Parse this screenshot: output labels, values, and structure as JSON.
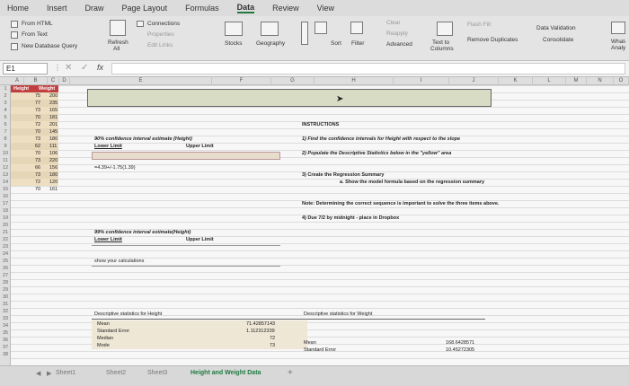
{
  "ribbon_tabs": [
    "Home",
    "Insert",
    "Draw",
    "Page Layout",
    "Formulas",
    "Data",
    "Review",
    "View"
  ],
  "active_tab": "Data",
  "ribbon": {
    "from_html": "From HTML",
    "from_text": "From Text",
    "new_db_query": "New Database Query",
    "refresh_all_1": "Refresh",
    "refresh_all_2": "All",
    "connections": "Connections",
    "properties": "Properties",
    "edit_links": "Edit Links",
    "stocks": "Stocks",
    "geography": "Geography",
    "sort": "Sort",
    "filter": "Filter",
    "clear": "Clear",
    "reapply": "Reapply",
    "advanced": "Advanced",
    "text_to_columns_1": "Text to",
    "text_to_columns_2": "Columns",
    "flash_fill": "Flash Fill",
    "remove_duplicates": "Remove Duplicates",
    "data_validation": "Data Validation",
    "consolidate": "Consolidate",
    "what_if_1": "What-",
    "what_if_2": "Analy"
  },
  "formula_bar": {
    "name_box": "E1",
    "fx": "fx"
  },
  "columns": [
    "A",
    "B",
    "C",
    "D",
    "E",
    "F",
    "G",
    "H",
    "I",
    "J",
    "K",
    "L",
    "M",
    "N",
    "O"
  ],
  "rows": [
    "1",
    "2",
    "3",
    "4",
    "5",
    "6",
    "7",
    "8",
    "9",
    "10",
    "11",
    "12",
    "13",
    "14",
    "15",
    "16",
    "17",
    "18",
    "19",
    "20",
    "21",
    "22",
    "23",
    "24",
    "25",
    "26",
    "27",
    "28",
    "29",
    "30",
    "31",
    "32",
    "33",
    "34",
    "35",
    "36",
    "37",
    "38"
  ],
  "headers": {
    "height": "Height",
    "weight": "Weight"
  },
  "data_rows": [
    {
      "h": "75",
      "w": "200"
    },
    {
      "h": "77",
      "w": "235"
    },
    {
      "h": "73",
      "w": "165"
    },
    {
      "h": "70",
      "w": "181"
    },
    {
      "h": "72",
      "w": "201"
    },
    {
      "h": "70",
      "w": "145"
    },
    {
      "h": "73",
      "w": "180"
    },
    {
      "h": "62",
      "w": "111"
    },
    {
      "h": "70",
      "w": "106"
    },
    {
      "h": "73",
      "w": "220"
    },
    {
      "h": "66",
      "w": "156"
    },
    {
      "h": "73",
      "w": "180"
    },
    {
      "h": "72",
      "w": "120"
    },
    {
      "h": "70",
      "w": "161"
    }
  ],
  "ci90": {
    "title": "90% confidence interval estimate (Height)",
    "lower": "Lower Limit",
    "upper": "Upper Limit",
    "formula": "=4.39+/-1.75(1.39)"
  },
  "ci99": {
    "title": "99% confidence interval estimate(Height)",
    "lower": "Lower Limit",
    "upper": "Upper Limit"
  },
  "show_calc": "show your calculations",
  "instructions": {
    "heading": "INSTRUCTIONS",
    "i1": "1) Find the confidence intervals for Height with respect to the slope",
    "i2": "2) Populate the Descriptive Statistics below in the \"yellow\" area",
    "i3": "3) Create the Regression Summary",
    "i3a": "a. Show the model formula based on the regression summary",
    "note": "Note: Determining the correct sequence is important to solve the three items above.",
    "i4": "4) Due 7/2 by midnight - place in Dropbox"
  },
  "desc_height": {
    "title": "Descriptive statistics for Height",
    "labels": [
      "Mean",
      "Standard Error",
      "Median",
      "Mode"
    ],
    "values": [
      "71.42857143",
      "1.112312339",
      "72",
      "73"
    ]
  },
  "desc_weight": {
    "title": "Descriptive statistics for Weight",
    "labels": [
      "Mean",
      "Standard Error"
    ],
    "values": [
      "168.6428571",
      "10.45272305"
    ]
  },
  "sheet_tabs": [
    "Sheet1",
    "Sheet2",
    "Sheet3",
    "Height and Weight Data"
  ],
  "active_sheet": "Height and Weight Data",
  "add_sheet": "+"
}
